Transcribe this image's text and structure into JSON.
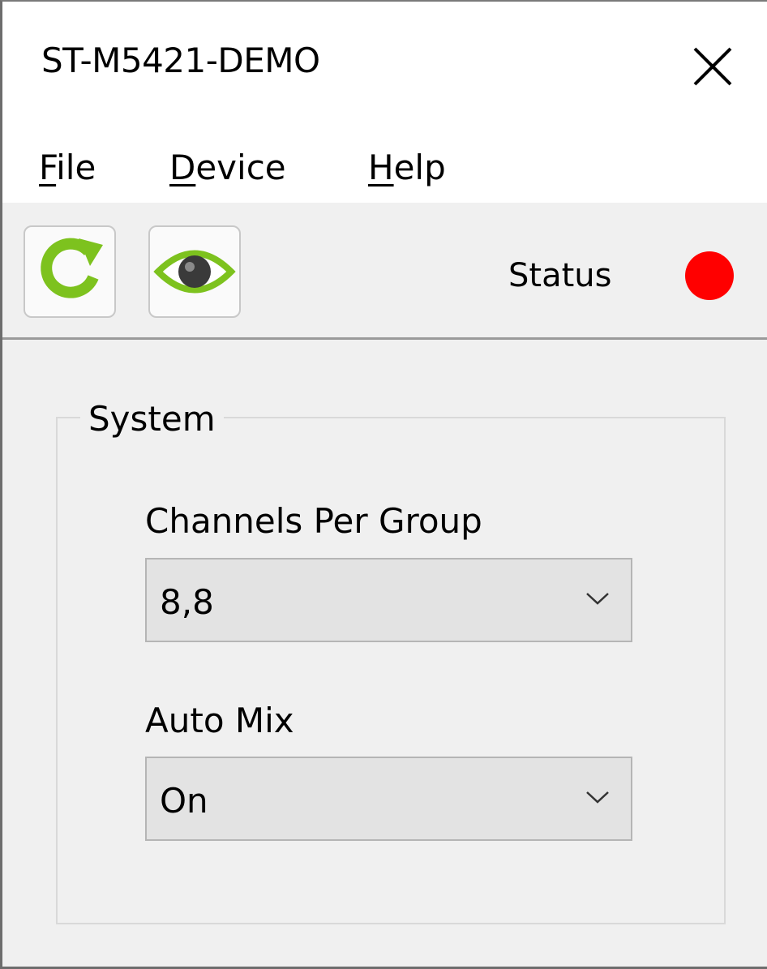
{
  "window": {
    "title": "ST-M5421-DEMO"
  },
  "menu": {
    "items": [
      {
        "accel": "F",
        "rest": "ile"
      },
      {
        "accel": "D",
        "rest": "evice"
      },
      {
        "accel": "H",
        "rest": "elp"
      }
    ]
  },
  "toolbar": {
    "refresh_icon": "refresh-icon",
    "view_icon": "eye-icon",
    "status_label": "Status",
    "status_color": "#ff0000"
  },
  "system": {
    "group_title": "System",
    "channels_label": "Channels Per Group",
    "channels_value": "8,8",
    "automix_label": "Auto Mix",
    "automix_value": "On"
  },
  "colors": {
    "icon_green": "#7dc21e",
    "status_red": "#ff0000"
  }
}
